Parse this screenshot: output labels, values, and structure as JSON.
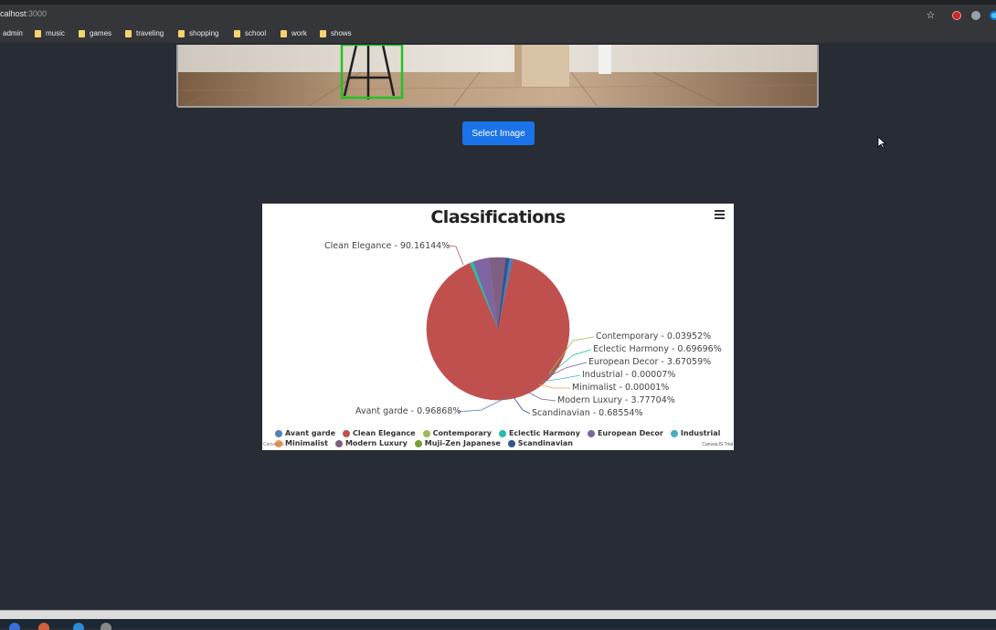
{
  "browser": {
    "url_host": "calhost",
    "url_rest": ":3000",
    "bookmarks": [
      {
        "label": "admin"
      },
      {
        "label": "music"
      },
      {
        "label": "games"
      },
      {
        "label": "traveling"
      },
      {
        "label": "shopping"
      },
      {
        "label": "school"
      },
      {
        "label": "work"
      },
      {
        "label": "shows"
      }
    ]
  },
  "main": {
    "select_button_label": "Select Image"
  },
  "chart_data": {
    "type": "pie",
    "title": "Classifications",
    "series": [
      {
        "name": "Avant garde",
        "value": 0.96868,
        "label": "Avant garde - 0.96868%",
        "color": "#4f81bc"
      },
      {
        "name": "Clean Elegance",
        "value": 90.16144,
        "label": "Clean Elegance - 90.16144%",
        "color": "#c0504e"
      },
      {
        "name": "Contemporary",
        "value": 0.03952,
        "label": "Contemporary - 0.03952%",
        "color": "#9bbb58"
      },
      {
        "name": "Eclectic Harmony",
        "value": 0.69696,
        "label": "Eclectic Harmony - 0.69696%",
        "color": "#23bfaa"
      },
      {
        "name": "European Decor",
        "value": 3.67059,
        "label": "European Decor - 3.67059%",
        "color": "#8064a1"
      },
      {
        "name": "Industrial",
        "value": 7e-05,
        "label": "Industrial - 0.00007%",
        "color": "#4aacc5"
      },
      {
        "name": "Minimalist",
        "value": 1e-05,
        "label": "Minimalist - 0.00001%",
        "color": "#f79647"
      },
      {
        "name": "Modern Luxury",
        "value": 3.77704,
        "label": "Modern Luxury - 3.77704%",
        "color": "#7f6084"
      },
      {
        "name": "Muji-Zen Japanese",
        "value": 0.0,
        "label": "",
        "color": "#77a033"
      },
      {
        "name": "Scandinavian",
        "value": 0.68554,
        "label": "Scandinavian - 0.68554%",
        "color": "#33558b"
      }
    ],
    "legend_rows": [
      [
        "Avant garde",
        "Clean Elegance",
        "Contemporary",
        "Eclectic Harmony",
        "European Decor",
        "Industrial"
      ],
      [
        "Minimalist",
        "Modern Luxury",
        "Muji-Zen Japanese",
        "Scandinavian"
      ]
    ],
    "legend_placement": "bottom",
    "credit_left": "CanvasJS",
    "credit_right": "CanvasJS Trial"
  }
}
